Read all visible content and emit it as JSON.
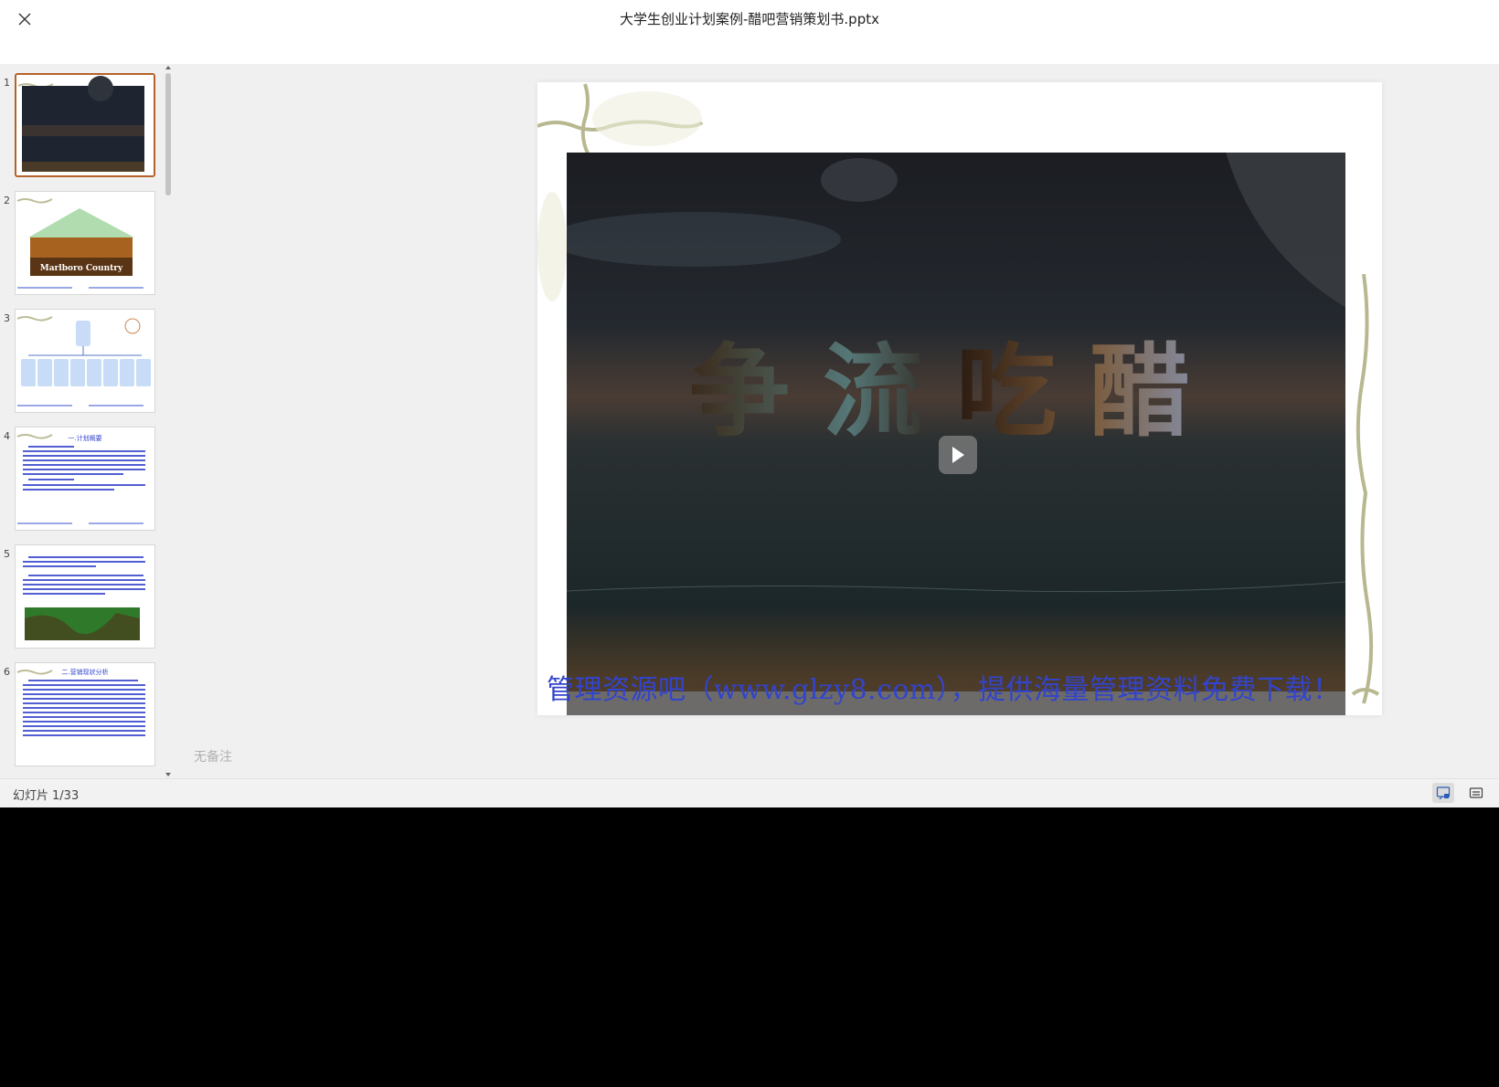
{
  "window": {
    "title": "大学生创业计划案例-醋吧营销策划书.pptx"
  },
  "thumbnails": [
    {
      "number": "1",
      "selected": true
    },
    {
      "number": "2",
      "caption": "Marlboro Country"
    },
    {
      "number": "3"
    },
    {
      "number": "4",
      "heading": "一.计划概要"
    },
    {
      "number": "5"
    },
    {
      "number": "6",
      "heading": "二.营销现状分析"
    }
  ],
  "slide": {
    "title_art": "争流吃醋",
    "footer_text": "管理资源吧（www.glzy8.com），提供海量管理资料免费下载！"
  },
  "notes": {
    "placeholder": "无备注"
  },
  "statusbar": {
    "label": "幻灯片",
    "count": "1/33"
  },
  "colors": {
    "accent_selected": "#b5622a",
    "footer_text": "#3344cc",
    "background": "#f0f0f0"
  },
  "icons": [
    "close-icon",
    "play-icon",
    "notes-toggle-icon",
    "subtitle-icon"
  ]
}
